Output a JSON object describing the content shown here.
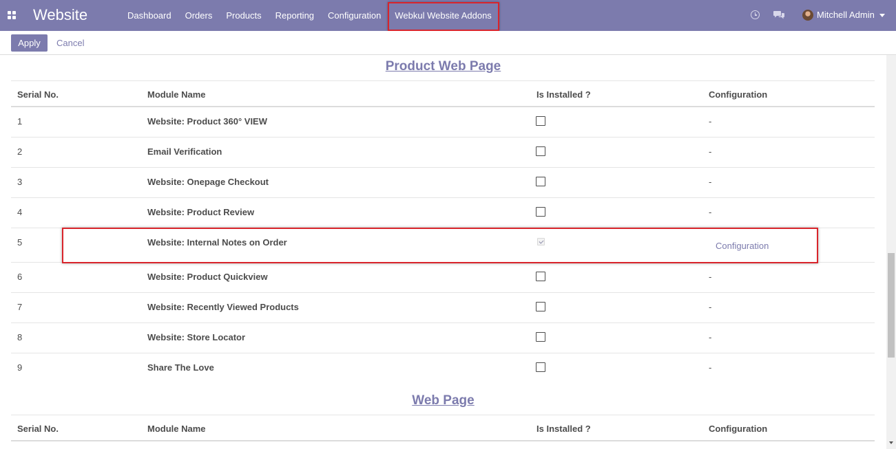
{
  "navbar": {
    "brand": "Website",
    "menu": [
      "Dashboard",
      "Orders",
      "Products",
      "Reporting",
      "Configuration",
      "Webkul Website Addons"
    ],
    "user": "Mitchell Admin"
  },
  "control": {
    "apply": "Apply",
    "cancel": "Cancel"
  },
  "columns": [
    "Serial No.",
    "Module Name",
    "Is Installed ?",
    "Configuration"
  ],
  "sections": [
    {
      "title": "Product Web Page",
      "rows": [
        {
          "serial": "1",
          "name": "Website: Product 360° VIEW",
          "installed": false,
          "config": "-"
        },
        {
          "serial": "2",
          "name": "Email Verification",
          "installed": false,
          "config": "-"
        },
        {
          "serial": "3",
          "name": "Website: Onepage Checkout",
          "installed": false,
          "config": "-"
        },
        {
          "serial": "4",
          "name": "Website: Product Review",
          "installed": false,
          "config": "-"
        },
        {
          "serial": "5",
          "name": "Website: Internal Notes on Order",
          "installed": true,
          "config": "Configuration"
        },
        {
          "serial": "6",
          "name": "Website: Product Quickview",
          "installed": false,
          "config": "-"
        },
        {
          "serial": "7",
          "name": "Website: Recently Viewed Products",
          "installed": false,
          "config": "-"
        },
        {
          "serial": "8",
          "name": "Website: Store Locator",
          "installed": false,
          "config": "-"
        },
        {
          "serial": "9",
          "name": "Share The Love",
          "installed": false,
          "config": "-"
        }
      ]
    },
    {
      "title": "Web Page",
      "rows": []
    }
  ],
  "colors": {
    "brand": "#7c7bad",
    "highlight": "#d9242b"
  }
}
